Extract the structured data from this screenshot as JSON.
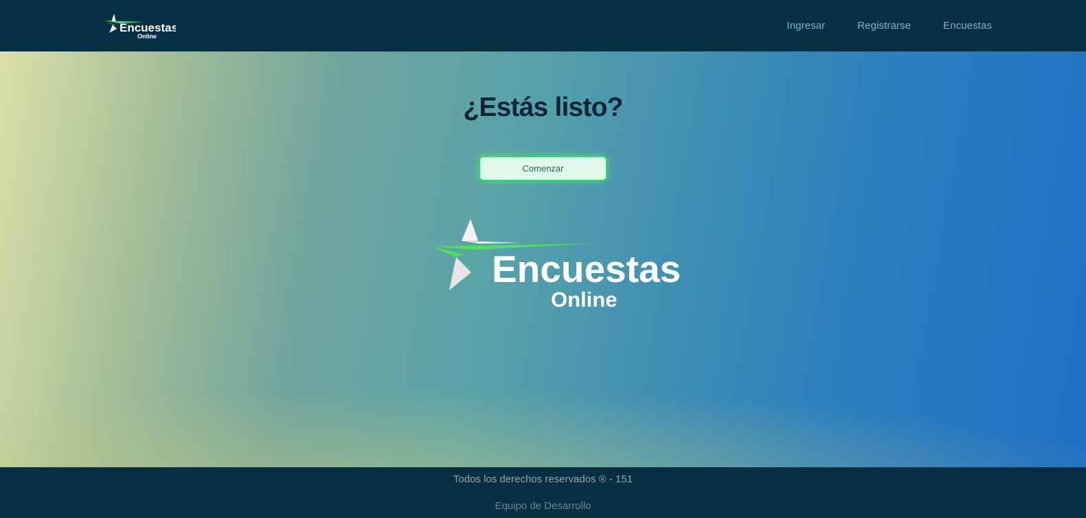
{
  "navbar": {
    "logo": {
      "title": "Encuestas",
      "subtitle": "Online"
    },
    "links": [
      {
        "label": "Ingresar"
      },
      {
        "label": "Registrarse"
      },
      {
        "label": "Encuestas"
      }
    ]
  },
  "hero": {
    "title": "¿Estás listo?",
    "button_label": "Comenzar",
    "logo": {
      "title": "Encuestas",
      "subtitle": "Online"
    }
  },
  "footer": {
    "rights": "Todos los derechos reservados ® - 151",
    "team": "Equipo de Desarrollo"
  },
  "colors": {
    "header_bg": "#062f44",
    "accent_green": "#34d46a",
    "button_bg": "#dff8ea",
    "nav_link": "#7fb7c6"
  }
}
